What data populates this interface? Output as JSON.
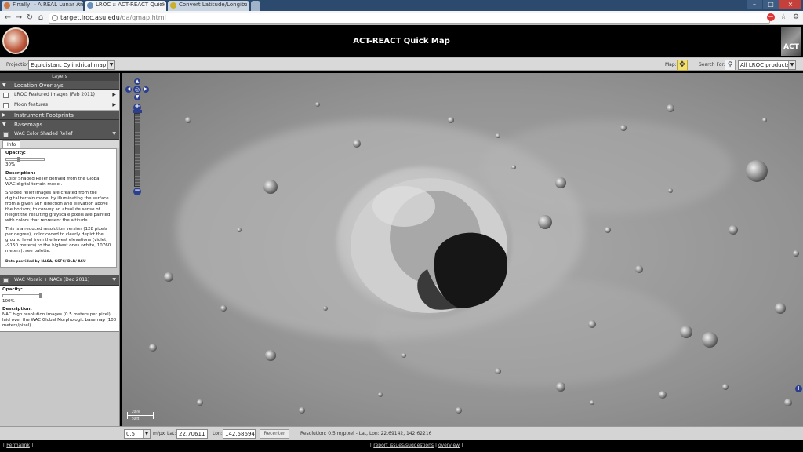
{
  "browser": {
    "tabs": [
      {
        "label": "Finally! - A REAL Lunar Ano"
      },
      {
        "label": "LROC :: ACT-REACT Quick"
      },
      {
        "label": "Convert Latitude/Longitu"
      }
    ],
    "url_host": "target.lroc.asu.edu",
    "url_path": "/da/qmap.html"
  },
  "app": {
    "title": "ACT-REACT Quick Map",
    "logo_right_text": "ACT"
  },
  "toolbar": {
    "projection_label": "Projection:",
    "projection_value": "Equidistant Cylindrical map",
    "map_label": "Map:",
    "search_label": "Search For:",
    "search_value": "All LROC products"
  },
  "sidebar": {
    "header": "Layers",
    "location_overlays": "Location Overlays",
    "featured_images": "LROC Featured Images (Feb 2011)",
    "moon_features": "Moon features",
    "instrument_footprints": "Instrument Footprints",
    "basemaps": "Basemaps",
    "wac_shaded": {
      "label": "WAC Color Shaded Relief",
      "tab": "Info",
      "opacity_label": "Opacity:",
      "opacity_value": "30%",
      "opacity_fraction": 0.3,
      "desc_label": "Description:",
      "desc_1": "Color Shaded Relief derived from the Global WAC digital terrain model.",
      "desc_2": "Shaded relief images are created from the digital terrain model by illuminating the surface from a given Sun direction and elevation above the horizon; to convey an absolute sense of height the resulting grayscale pixels are painted with colors that represent the altitude.",
      "desc_3_pre": "This is a reduced resolution version (128 pixels per degree), color coded to clearly depict the ground level from the lowest elevations (violet, -9150 meters) to the highest ones (white, 10760 meters). see ",
      "desc_3_link": "palette",
      "desc_3_post": ".",
      "credit": "Data provided by NASA/ GSFC/ DLR/ ASU"
    },
    "wac_mosaic": {
      "label": "WAC Mosaic + NACs (Dec 2011)",
      "opacity_label": "Opacity:",
      "opacity_value": "100%",
      "opacity_fraction": 1.0,
      "desc_label": "Description:",
      "desc": "NAC high resolution images (0.5 meters per pixel) laid over the WAC Global Morphologic basemap (100 meters/pixel)."
    }
  },
  "map": {
    "scale_top": "20 m",
    "scale_bottom": "50 ft"
  },
  "statusbar": {
    "scale_value": "0.5",
    "scale_unit": "m/px",
    "lat_label": "Lat:",
    "lat_value": "22.70611",
    "lon_label": "Lon:",
    "lon_value": "142.58694",
    "recenter_label": "Recenter",
    "resolution_text": "Resolution: 0.5 m/pixel - Lat, Lon: 22.69142, 142.62216"
  },
  "footer": {
    "permalink": "Permalink",
    "report_issues": "report issues/suggestions",
    "overview": "overview"
  },
  "icons": {
    "pan": "pan-move-icon",
    "search": "binoculars-icon"
  }
}
